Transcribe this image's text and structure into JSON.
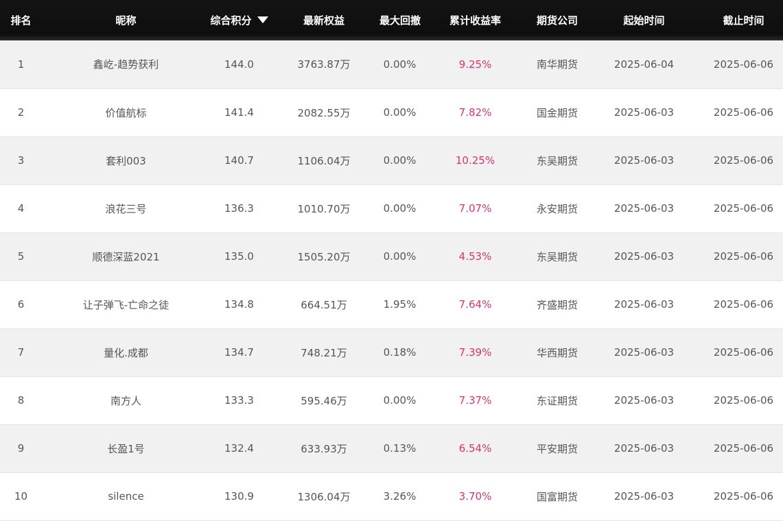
{
  "table": {
    "headers": [
      "排名",
      "昵称",
      "综合积分",
      "最新权益",
      "最大回撤",
      "累计收益率",
      "期货公司",
      "起始时间",
      "截止时间"
    ],
    "sort_column": "综合积分",
    "sort_direction": "descending",
    "rows": [
      [
        "1",
        "鑫屹-趋势获利",
        "144.0",
        "3763.87万",
        "0.00%",
        "9.25%",
        "南华期货",
        "2025-06-04",
        "2025-06-06"
      ],
      [
        "2",
        "价值航标",
        "141.4",
        "2082.55万",
        "0.00%",
        "7.82%",
        "国金期货",
        "2025-06-03",
        "2025-06-06"
      ],
      [
        "3",
        "套利003",
        "140.7",
        "1106.04万",
        "0.00%",
        "10.25%",
        "东吴期货",
        "2025-06-03",
        "2025-06-06"
      ],
      [
        "4",
        "浪花三号",
        "136.3",
        "1010.70万",
        "0.00%",
        "7.07%",
        "永安期货",
        "2025-06-03",
        "2025-06-06"
      ],
      [
        "5",
        "顺德深蓝2021",
        "135.0",
        "1505.20万",
        "0.00%",
        "4.53%",
        "东吴期货",
        "2025-06-03",
        "2025-06-06"
      ],
      [
        "6",
        "让子弹飞-亡命之徒",
        "134.8",
        "664.51万",
        "1.95%",
        "7.64%",
        "齐盛期货",
        "2025-06-03",
        "2025-06-06"
      ],
      [
        "7",
        "量化.成都",
        "134.7",
        "748.21万",
        "0.18%",
        "7.39%",
        "华西期货",
        "2025-06-03",
        "2025-06-06"
      ],
      [
        "8",
        "南方人",
        "133.3",
        "595.46万",
        "0.00%",
        "7.37%",
        "东证期货",
        "2025-06-03",
        "2025-06-06"
      ],
      [
        "9",
        "长盈1号",
        "132.4",
        "633.93万",
        "0.13%",
        "6.54%",
        "平安期货",
        "2025-06-03",
        "2025-06-06"
      ],
      [
        "10",
        "silence",
        "130.9",
        "1306.04万",
        "3.26%",
        "3.70%",
        "国富期货",
        "2025-06-03",
        "2025-06-06"
      ]
    ]
  },
  "colors": {
    "header_background": "#111111",
    "header_text": "#ffffff",
    "row_odd": "#f1f1f1",
    "row_even": "#ffffff",
    "cell_text": "#555555",
    "return_rate": "#d9366b"
  },
  "icons": {
    "sort": "sort-descending-triangle-icon"
  }
}
